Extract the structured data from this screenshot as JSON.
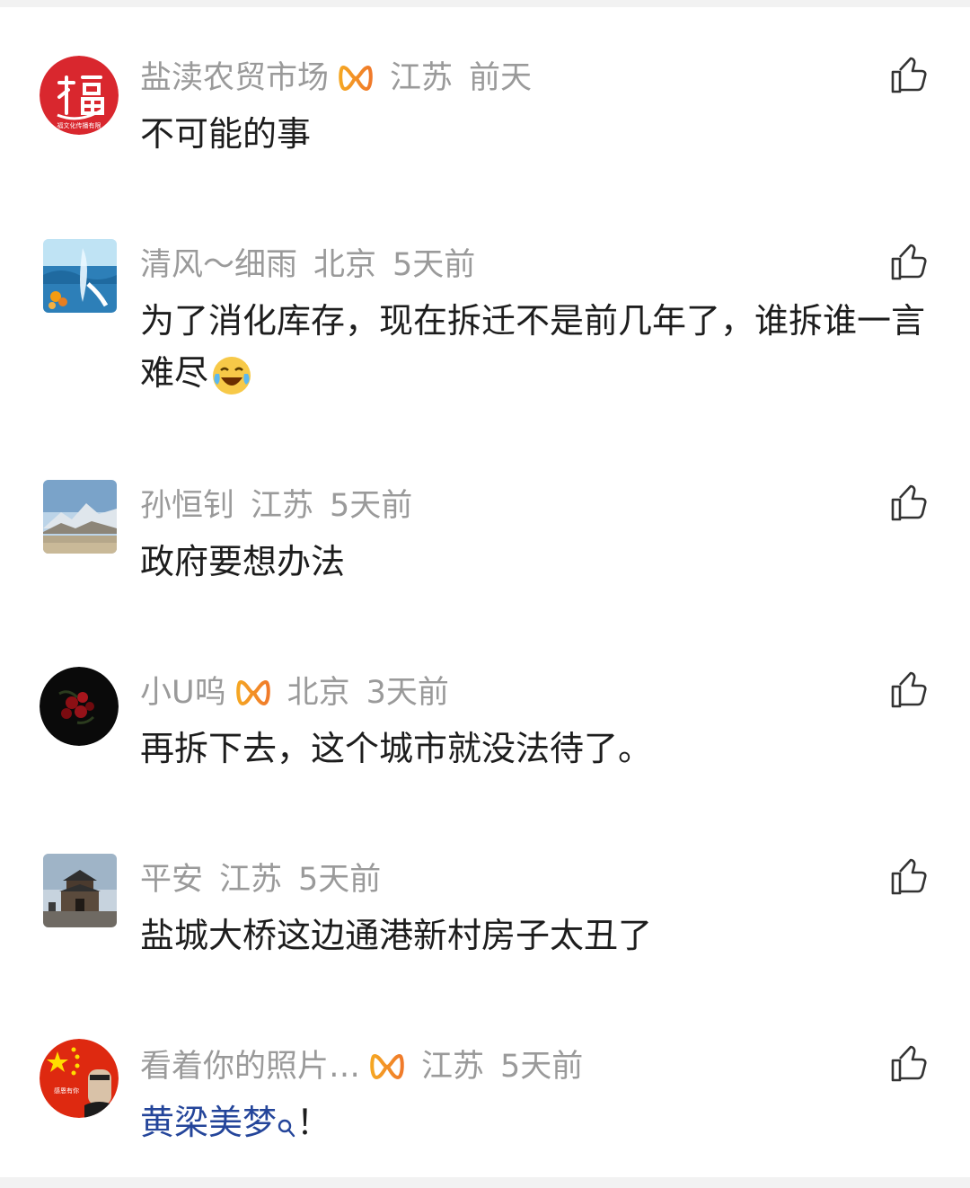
{
  "comments": [
    {
      "user": "盐渎农贸市场",
      "vip": true,
      "location": "江苏",
      "time": "前天",
      "text": "不可能的事",
      "avatar": "fu-character-avatar",
      "avatar_caption": "福文化传播有限",
      "avatar_color": "#d9272e"
    },
    {
      "user": "清风～细雨",
      "vip": false,
      "location": "北京",
      "time": "5天前",
      "text": "为了消化库存，现在拆迁不是前几年了，谁拆谁一言难尽",
      "emoji": "crying-laughing-emoji",
      "avatar": "water-splash-avatar",
      "avatar_color": "#2d7fb8"
    },
    {
      "user": "孙恒钊",
      "vip": false,
      "location": "江苏",
      "time": "5天前",
      "text": "政府要想办法",
      "avatar": "snow-mountain-avatar",
      "avatar_color": "#7aa3c9"
    },
    {
      "user": "小U呜",
      "vip": true,
      "location": "北京",
      "time": "3天前",
      "text": "再拆下去，这个城市就没法待了。",
      "avatar": "red-roses-avatar",
      "avatar_color": "#0a0a0a"
    },
    {
      "user": "平安",
      "vip": false,
      "location": "江苏",
      "time": "5天前",
      "text": "盐城大桥这边通港新村房子太丑了",
      "avatar": "ancient-gate-tower-avatar",
      "avatar_color": "#8aa0b5"
    },
    {
      "user": "看着你的照片…",
      "vip": true,
      "location": "江苏",
      "time": "5天前",
      "text_link": "黄梁美梦",
      "text_suffix": "！",
      "avatar": "china-flag-avatar",
      "avatar_caption": "感恩有你",
      "avatar_color": "#de2910"
    }
  ],
  "colors": {
    "meta": "#9a9a9a",
    "text": "#1d1d1d",
    "link": "#24459a",
    "vip_gradient": [
      "#f5a623",
      "#f07a2a"
    ]
  },
  "icons": {
    "like": "thumbs-up-icon",
    "vip": "vip-badge-icon",
    "search": "search-icon"
  }
}
